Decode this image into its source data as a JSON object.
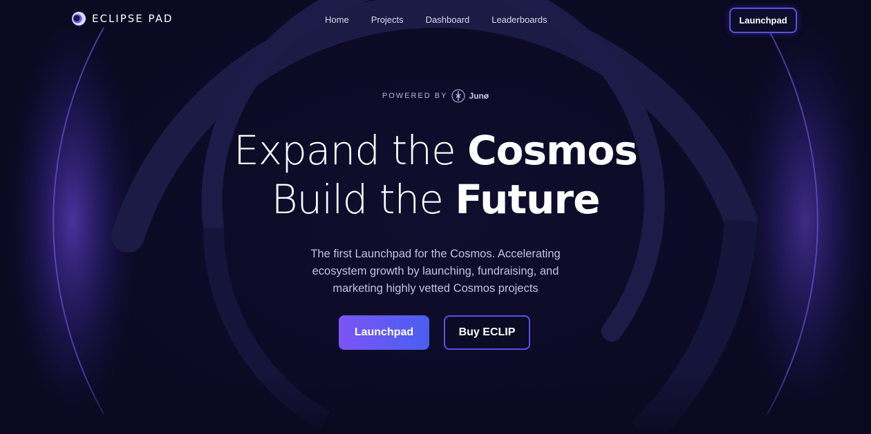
{
  "brand": {
    "name": "ECLIPSE PAD",
    "logo_icon": "eclipse-logo-icon"
  },
  "nav": {
    "links": [
      "Home",
      "Projects",
      "Dashboard",
      "Leaderboards"
    ],
    "cta_label": "Launchpad"
  },
  "hero": {
    "powered_by": "POWERED BY",
    "partner_name": "Junø",
    "partner_icon": "juno-logo-icon",
    "headline_line1_light": "Expand the ",
    "headline_line1_bold": "Cosmos",
    "headline_line2_light": "Build the ",
    "headline_line2_bold": "Future",
    "subtitle_lines": [
      "The first Launchpad for the Cosmos. Accelerating",
      "ecosystem growth by launching, fundraising, and",
      "marketing highly vetted Cosmos projects"
    ],
    "primary_button": "Launchpad",
    "secondary_button": "Buy ECLIP"
  },
  "colors": {
    "background": "#0b0a24",
    "accent": "#5a4ff0",
    "accent_gradient_start": "#7b55f5",
    "accent_gradient_end": "#4a5ef0",
    "glow": "#6a4df5"
  }
}
